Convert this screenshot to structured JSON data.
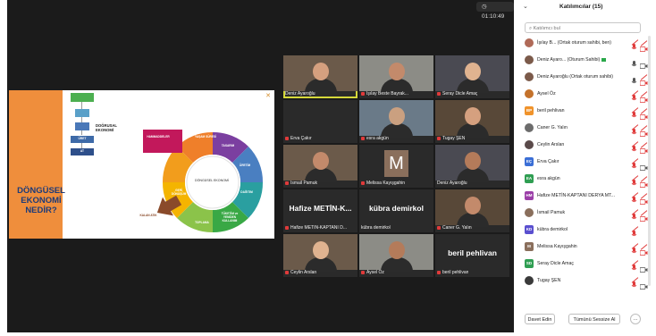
{
  "toolbar": {
    "timer": "01:10:49"
  },
  "slide": {
    "title": "DÖNGÜSEL\nEKONOMİ\nNEDİR?",
    "linear_label": "DOĞRUSAL\nEKONOMİ",
    "linear_steps": [
      "ÜRET",
      "AT"
    ],
    "wheel_center": "DÖNGÜSEL EKONOMİ",
    "wheel_labels": [
      "YAŞAM SÜRESİ",
      "TASARIM",
      "ÜRETİM",
      "DAĞITIM",
      "TÜKETİM ve YENİDEN KULLANIM",
      "TOPLAMA",
      "GERİ DÖNÜŞÜM",
      "HAMMADDELER"
    ],
    "residue_label": "KALAN ATIK"
  },
  "tiles": [
    {
      "name": "Deniz Ayaroğlu",
      "muted": false,
      "kind": "video",
      "active": true
    },
    {
      "name": "İşılay Beste Bayrak...",
      "muted": true,
      "kind": "video"
    },
    {
      "name": "Seray Dicle Amaç",
      "muted": true,
      "kind": "video"
    },
    {
      "name": "Erva Çakır",
      "muted": true,
      "kind": "dark"
    },
    {
      "name": "esra akgün",
      "muted": true,
      "kind": "video"
    },
    {
      "name": "Tugay ŞEN",
      "muted": true,
      "kind": "video"
    },
    {
      "name": "İsmail Pamuk",
      "muted": true,
      "kind": "video"
    },
    {
      "name": "Melissa Kayışgahin",
      "muted": true,
      "kind": "avatar",
      "letter": "M"
    },
    {
      "name": "Deniz Ayaroğlu",
      "muted": false,
      "kind": "video"
    },
    {
      "name": "Hafize METİN-KAPTANI D...",
      "muted": true,
      "kind": "text",
      "big": "Hafize METİN-K..."
    },
    {
      "name": "kübra demirkol",
      "muted": false,
      "kind": "text",
      "big": "kübra demirkol"
    },
    {
      "name": "Caner G. Yalın",
      "muted": true,
      "kind": "video"
    },
    {
      "name": "Ceylin Arslan",
      "muted": true,
      "kind": "video"
    },
    {
      "name": "Aysel Öz",
      "muted": true,
      "kind": "video"
    },
    {
      "name": "beril pehlivan",
      "muted": true,
      "kind": "text",
      "big": "beril pehlivan"
    }
  ],
  "panel": {
    "title": "Katılımcılar (15)",
    "search_placeholder": "Katılımcı bul",
    "participants": [
      {
        "name": "İşılay B...  (Ortak oturum sahibi, ben)",
        "avatar": "photo",
        "color": "#b06a58",
        "mic_muted": true,
        "cam_muted": true
      },
      {
        "name": "Deniz Ayaro...  (Oturum Sahibi)",
        "avatar": "photo",
        "color": "#7b5a4a",
        "mic_muted": false,
        "cam_muted": false,
        "badge": true
      },
      {
        "name": "Deniz Ayaroğlu (Ortak oturum sahibi)",
        "avatar": "photo",
        "color": "#7b5a4a",
        "mic_muted": false,
        "cam_muted": true
      },
      {
        "name": "Aysel Öz",
        "avatar": "photo",
        "color": "#c4722b",
        "mic_muted": true,
        "cam_muted": true
      },
      {
        "name": "beril pehlivan",
        "avatar": "BP",
        "color": "#f0932b",
        "mic_muted": true,
        "cam_muted": true
      },
      {
        "name": "Caner G. Yalın",
        "avatar": "photo",
        "color": "#6c6c6c",
        "mic_muted": true,
        "cam_muted": true
      },
      {
        "name": "Ceylin Arslan",
        "avatar": "photo",
        "color": "#5a4a4a",
        "mic_muted": true,
        "cam_muted": true
      },
      {
        "name": "Erva Çakır",
        "avatar": "EÇ",
        "color": "#3b6fd6",
        "mic_muted": true,
        "cam_muted": false
      },
      {
        "name": "esra akgün",
        "avatar": "EA",
        "color": "#2f9e52",
        "mic_muted": true,
        "cam_muted": true
      },
      {
        "name": "Hafize METİN-KAPTANI DERYA MT...",
        "avatar": "HM",
        "color": "#9b3fa8",
        "mic_muted": true,
        "cam_muted": true
      },
      {
        "name": "İsmail Pamuk",
        "avatar": "photo",
        "color": "#8a6f5c",
        "mic_muted": true,
        "cam_muted": true
      },
      {
        "name": "kübra demirkol",
        "avatar": "KD",
        "color": "#5a4fcf",
        "mic_muted": true,
        "cam_muted": null
      },
      {
        "name": "Melissa Kayışgahin",
        "avatar": "M",
        "color": "#8a6f5c",
        "mic_muted": true,
        "cam_muted": true
      },
      {
        "name": "Seray Dicle Amaç",
        "avatar": "SD",
        "color": "#2f9e52",
        "mic_muted": true,
        "cam_muted": false
      },
      {
        "name": "Tugay ŞEN",
        "avatar": "photo",
        "color": "#3a3a3a",
        "mic_muted": true,
        "cam_muted": false
      }
    ],
    "invite_label": "Davet Edin",
    "mute_all_label": "Tümünü Sessize Al",
    "more_label": "···"
  }
}
